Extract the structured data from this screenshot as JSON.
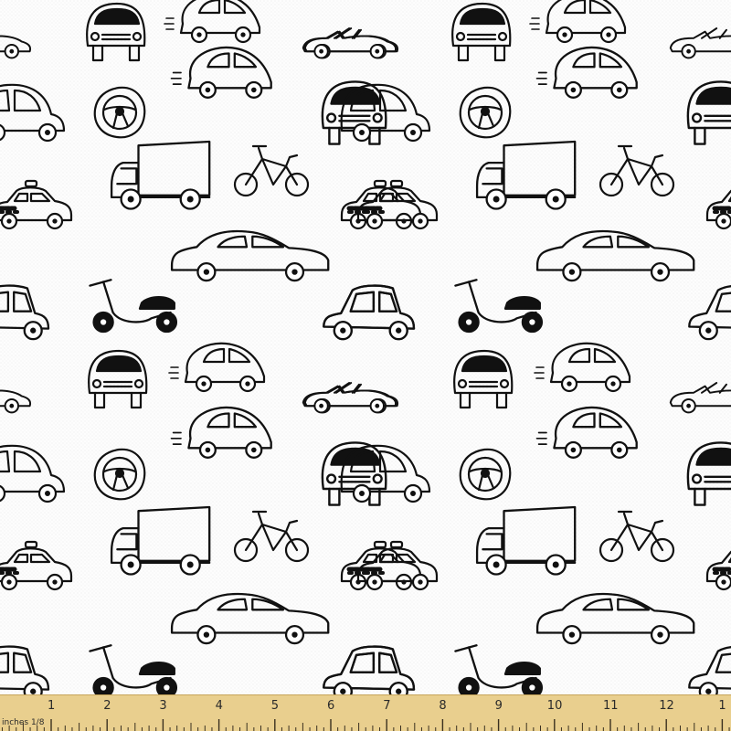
{
  "fabric": {
    "pattern": "hand-drawn black outline vehicles on white textured fabric",
    "colors": {
      "ink": "#111111",
      "background": "#fdfdfd",
      "ruler": "#e9cf8e",
      "ruler_text": "#2a2a2a"
    },
    "motifs": [
      "taxi-icon",
      "sedan-car-icon",
      "scooter-icon",
      "bubble-car-icon",
      "convertible-car-icon",
      "front-car-icon",
      "steering-wheel-icon",
      "delivery-truck-icon",
      "bicycle-icon",
      "boxy-car-icon",
      "hatchback-car-icon"
    ]
  },
  "ruler": {
    "unit_label": "inches 1/8",
    "numbers": [
      "1",
      "2",
      "3",
      "4",
      "5",
      "6",
      "7",
      "8",
      "9",
      "10",
      "11",
      "12",
      "1"
    ]
  }
}
